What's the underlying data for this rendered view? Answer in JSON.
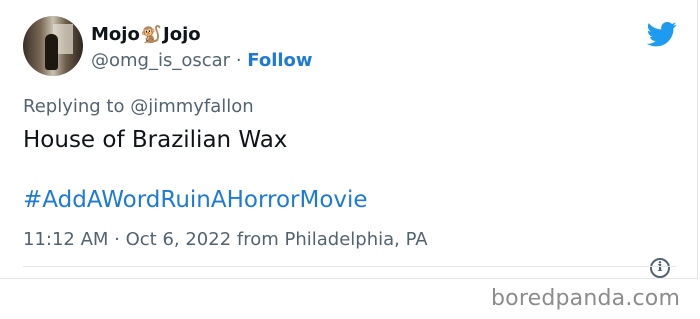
{
  "tweet": {
    "author": {
      "name_part1": "Mojo",
      "name_emoji": "🐒",
      "name_part2": "Jojo",
      "handle": "@omg_is_oscar",
      "separator": "·",
      "follow_label": "Follow"
    },
    "reply_to": "Replying to @jimmyfallon",
    "text": "House of Brazilian Wax",
    "hashtag": "#AddAWordRuinAHorrorMovie",
    "meta": "11:12 AM · Oct 6, 2022 from Philadelphia, PA",
    "info_glyph": "i",
    "icon_names": [
      "twitter-bird-icon",
      "info-icon",
      "avatar-photo"
    ]
  },
  "colors": {
    "accent": "#1d7bd6",
    "twitter_blue": "#1d9bf0",
    "muted_text": "#536471",
    "body_text": "#0f1419",
    "divider": "#e6e6e6",
    "watermark": "#8c8c8c"
  },
  "watermark": "boredpanda.com"
}
